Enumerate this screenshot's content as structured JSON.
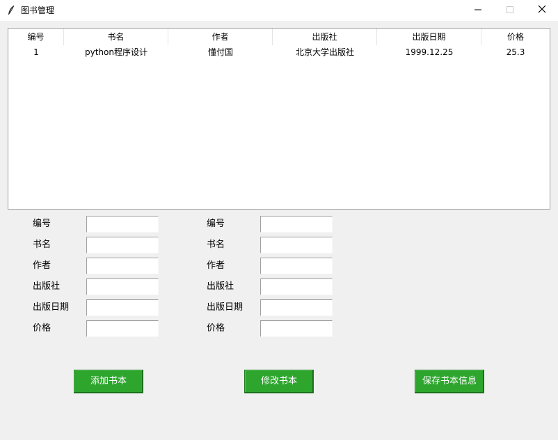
{
  "window": {
    "title": "图书管理",
    "icons": {
      "app": "feather-icon",
      "minimize": "minimize-icon",
      "maximize": "maximize-icon",
      "close": "close-icon"
    }
  },
  "table": {
    "columns": [
      "编号",
      "书名",
      "作者",
      "出版社",
      "出版日期",
      "价格"
    ],
    "rows": [
      [
        "1",
        "python程序设计",
        "懂付国",
        "北京大学出版社",
        "1999.12.25",
        "25.3"
      ]
    ]
  },
  "form_left": {
    "labels": [
      "编号",
      "书名",
      "作者",
      "出版社",
      "出版日期",
      "价格"
    ],
    "values": [
      "",
      "",
      "",
      "",
      "",
      ""
    ]
  },
  "form_right": {
    "labels": [
      "编号",
      "书名",
      "作者",
      "出版社",
      "出版日期",
      "价格"
    ],
    "values": [
      "",
      "",
      "",
      "",
      "",
      ""
    ]
  },
  "buttons": {
    "add": "添加书本",
    "edit": "修改书本",
    "save": "保存书本信息"
  },
  "colors": {
    "button_bg": "#2ea62e",
    "button_text": "#ffffff",
    "window_bg": "#f0f0f0"
  }
}
